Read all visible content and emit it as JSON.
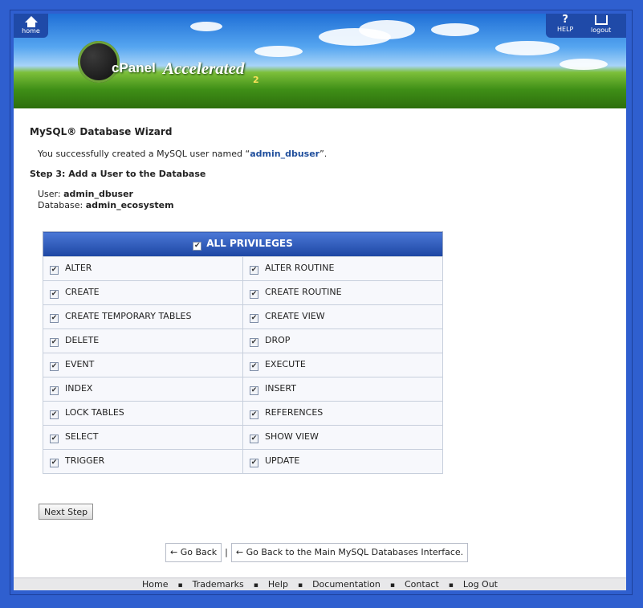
{
  "header": {
    "home_label": "home",
    "help_label": "HELP",
    "help_glyph": "?",
    "logout_label": "logout",
    "logo_text": "cPanel",
    "logo_accel": "Accelerated",
    "logo_version": "2"
  },
  "wizard": {
    "title": "MySQL® Database Wizard",
    "success_prefix": "You successfully created a MySQL user named “",
    "success_user": "admin_dbuser",
    "success_suffix": "”.",
    "step_title": "Step 3: Add a User to the Database",
    "user_label": "User:",
    "user_value": "admin_dbuser",
    "db_label": "Database:",
    "db_value": "admin_ecosystem"
  },
  "privileges": {
    "all_label": "ALL PRIVILEGES",
    "rows": [
      [
        "ALTER",
        "ALTER ROUTINE"
      ],
      [
        "CREATE",
        "CREATE ROUTINE"
      ],
      [
        "CREATE TEMPORARY TABLES",
        "CREATE VIEW"
      ],
      [
        "DELETE",
        "DROP"
      ],
      [
        "EVENT",
        "EXECUTE"
      ],
      [
        "INDEX",
        "INSERT"
      ],
      [
        "LOCK TABLES",
        "REFERENCES"
      ],
      [
        "SELECT",
        "SHOW VIEW"
      ],
      [
        "TRIGGER",
        "UPDATE"
      ]
    ]
  },
  "actions": {
    "next_step": "Next Step",
    "go_back": "← Go Back",
    "divider": "|",
    "go_back_main": "← Go Back to the Main MySQL Databases Interface."
  },
  "footer": {
    "links": [
      "Home",
      "Trademarks",
      "Help",
      "Documentation",
      "Contact",
      "Log Out"
    ],
    "bullet": "▪"
  }
}
